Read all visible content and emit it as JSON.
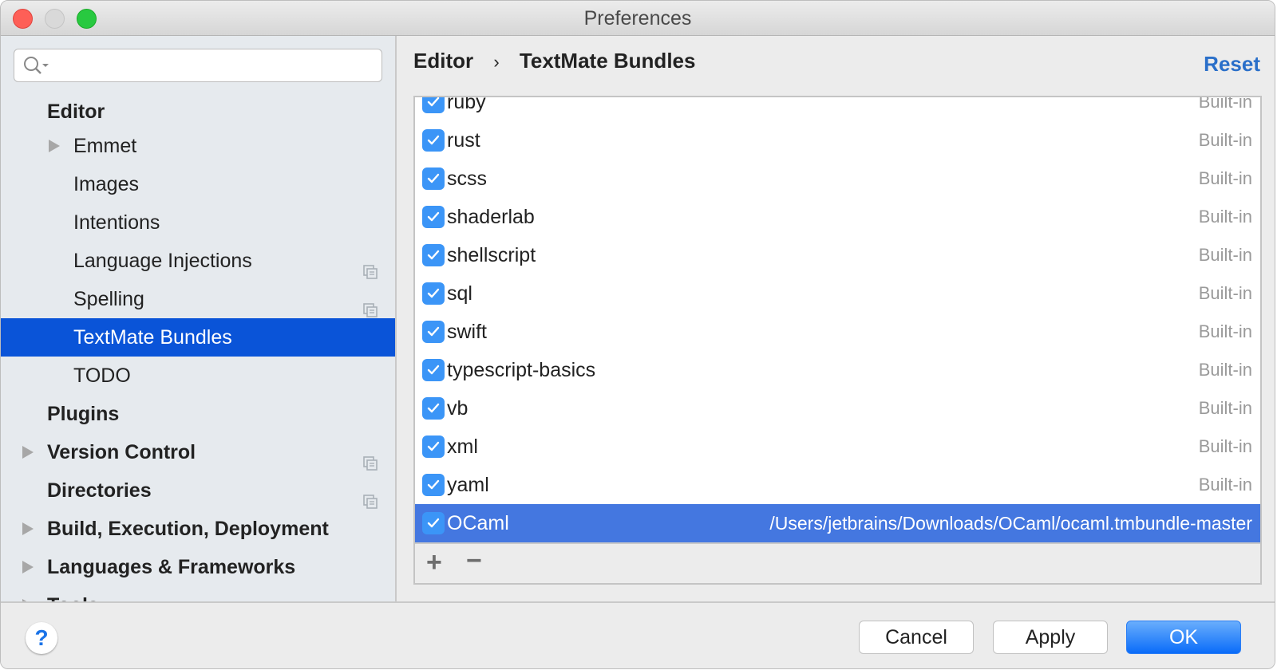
{
  "window": {
    "title": "Preferences"
  },
  "search": {
    "placeholder": ""
  },
  "sidebar": {
    "items": [
      {
        "label": "Editor",
        "level": 0,
        "bold": true,
        "expandable": false,
        "copy": false
      },
      {
        "label": "Emmet",
        "level": 1,
        "bold": false,
        "expandable": true,
        "copy": false
      },
      {
        "label": "Images",
        "level": 1,
        "bold": false,
        "expandable": false,
        "copy": false
      },
      {
        "label": "Intentions",
        "level": 1,
        "bold": false,
        "expandable": false,
        "copy": false
      },
      {
        "label": "Language Injections",
        "level": 1,
        "bold": false,
        "expandable": false,
        "copy": true
      },
      {
        "label": "Spelling",
        "level": 1,
        "bold": false,
        "expandable": false,
        "copy": true
      },
      {
        "label": "TextMate Bundles",
        "level": 1,
        "bold": false,
        "expandable": false,
        "copy": false,
        "selected": true
      },
      {
        "label": "TODO",
        "level": 1,
        "bold": false,
        "expandable": false,
        "copy": false
      },
      {
        "label": "Plugins",
        "level": 0,
        "bold": true,
        "expandable": false,
        "copy": false
      },
      {
        "label": "Version Control",
        "level": 0,
        "bold": true,
        "expandable": true,
        "copy": true
      },
      {
        "label": "Directories",
        "level": 0,
        "bold": true,
        "expandable": false,
        "copy": true
      },
      {
        "label": "Build, Execution, Deployment",
        "level": 0,
        "bold": true,
        "expandable": true,
        "copy": false
      },
      {
        "label": "Languages & Frameworks",
        "level": 0,
        "bold": true,
        "expandable": true,
        "copy": false
      },
      {
        "label": "Tools",
        "level": 0,
        "bold": true,
        "expandable": true,
        "copy": false
      }
    ]
  },
  "breadcrumb": {
    "parent": "Editor",
    "separator": "›",
    "current": "TextMate Bundles"
  },
  "reset_label": "Reset",
  "bundles": [
    {
      "name": "ruby",
      "source": "Built-in",
      "checked": true
    },
    {
      "name": "rust",
      "source": "Built-in",
      "checked": true
    },
    {
      "name": "scss",
      "source": "Built-in",
      "checked": true
    },
    {
      "name": "shaderlab",
      "source": "Built-in",
      "checked": true
    },
    {
      "name": "shellscript",
      "source": "Built-in",
      "checked": true
    },
    {
      "name": "sql",
      "source": "Built-in",
      "checked": true
    },
    {
      "name": "swift",
      "source": "Built-in",
      "checked": true
    },
    {
      "name": "typescript-basics",
      "source": "Built-in",
      "checked": true
    },
    {
      "name": "vb",
      "source": "Built-in",
      "checked": true
    },
    {
      "name": "xml",
      "source": "Built-in",
      "checked": true
    },
    {
      "name": "yaml",
      "source": "Built-in",
      "checked": true
    },
    {
      "name": "OCaml",
      "source": "/Users/jetbrains/Downloads/OCaml/ocaml.tmbundle-master",
      "checked": true,
      "selected": true
    }
  ],
  "toolbar": {
    "add": "+",
    "remove": "−"
  },
  "footer": {
    "help": "?",
    "cancel": "Cancel",
    "apply": "Apply",
    "ok": "OK"
  }
}
